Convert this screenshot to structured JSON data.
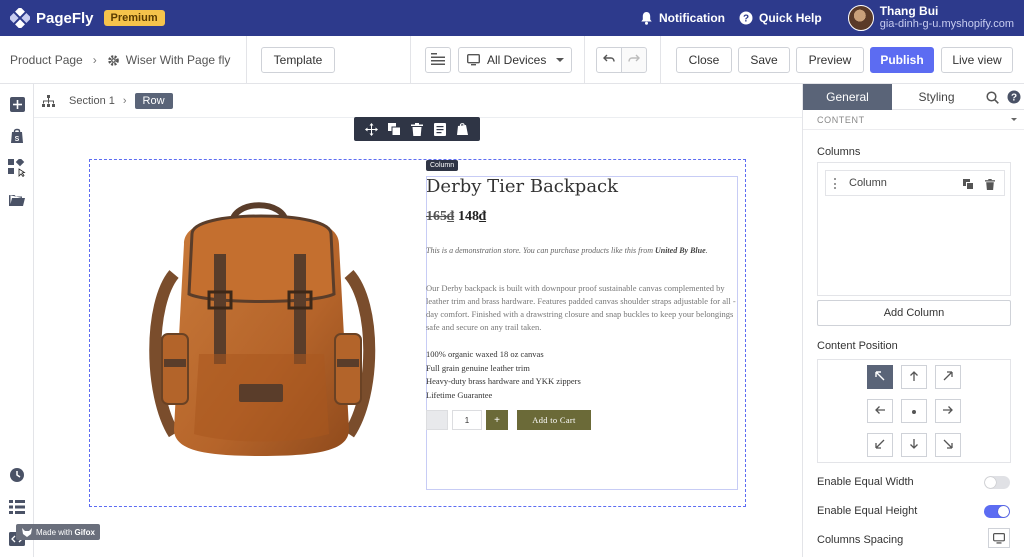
{
  "app": {
    "name": "PageFly",
    "badge": "Premium"
  },
  "header": {
    "notification": "Notification",
    "quick_help": "Quick Help",
    "user_name": "Thang Bui",
    "user_shop": "gia-dinh-g-u.myshopify.com"
  },
  "toolbar": {
    "breadcrumb_root": "Product Page",
    "page_name": "Wiser With Page fly",
    "template": "Template",
    "devices": "All Devices",
    "close": "Close",
    "save": "Save",
    "preview": "Preview",
    "publish": "Publish",
    "live_view": "Live view"
  },
  "canvas": {
    "crumb_section": "Section 1",
    "crumb_row": "Row",
    "column_tag": "Column",
    "product": {
      "title": "Derby Tier Backpack",
      "price_old": "165₫",
      "price_new": "148₫",
      "note": "This is a demonstration store. You can purchase products like this from",
      "note_brand": "United By Blue",
      "description": "Our Derby backpack is built with downpour proof sustainable canvas complemented by leather trim and brass hardware. Features padded canvas shoulder straps adjustable for all -day comfort. Finished with a drawstring closure and snap buckles to keep your belongings safe and secure on any trail taken.",
      "features": [
        "100% organic waxed 18 oz canvas",
        "Full grain genuine leather trim",
        "Heavy-duty brass hardware and YKK zippers",
        "Lifetime Guarantee"
      ],
      "quantity": "1",
      "plus": "+",
      "add_to_cart": "Add to Cart"
    }
  },
  "panel": {
    "tab_general": "General",
    "tab_styling": "Styling",
    "section": "CONTENT",
    "columns_label": "Columns",
    "column_item": "Column",
    "add_column": "Add Column",
    "content_position": "Content Position",
    "enable_equal_width": "Enable Equal Width",
    "equal_width_on": false,
    "enable_equal_height": "Enable Equal Height",
    "equal_height_on": true,
    "columns_spacing": "Columns Spacing"
  },
  "watermark": {
    "prefix": "Made with",
    "brand": "Gifox"
  },
  "colors": {
    "topbar": "#2d3a8c",
    "primary": "#5c6cf2",
    "premium": "#f5c34b",
    "cart_button": "#6b6a38"
  }
}
